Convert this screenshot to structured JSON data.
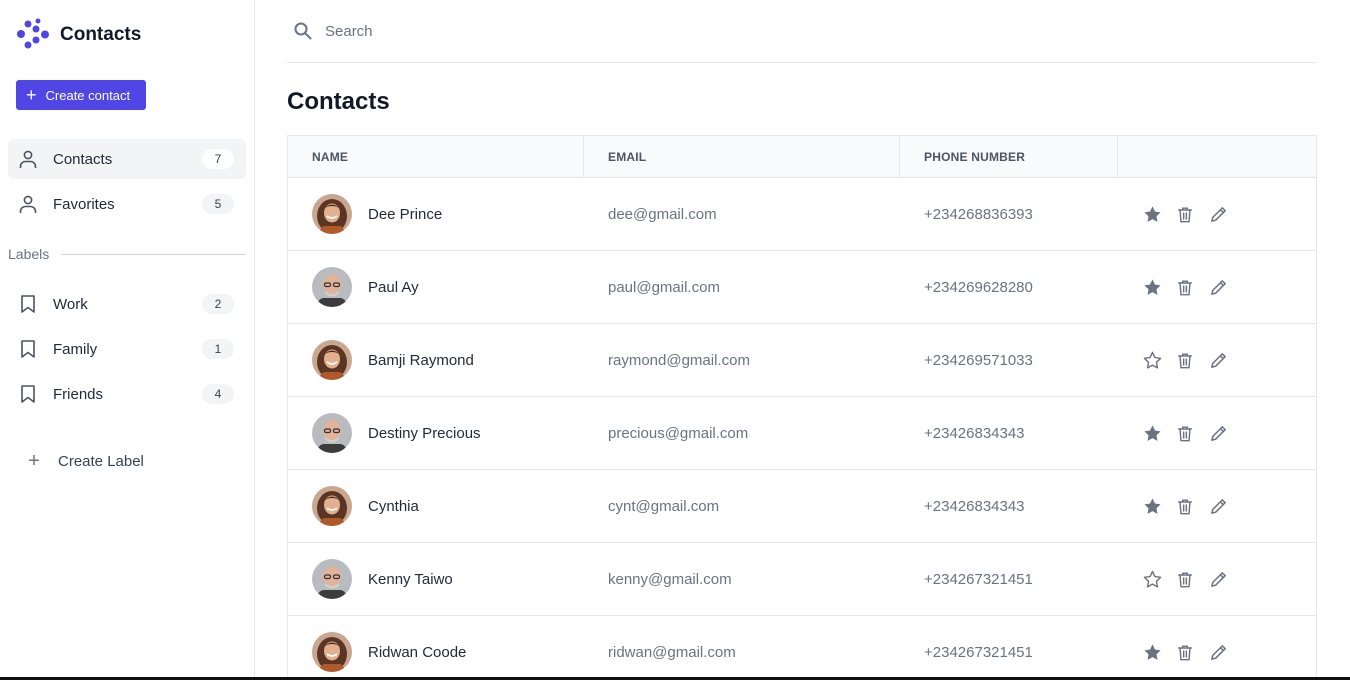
{
  "brand": {
    "name": "Contacts",
    "accent": "#4f46e5"
  },
  "sidebar": {
    "create_label": "Create contact",
    "nav": [
      {
        "label": "Contacts",
        "count": "7",
        "icon": "user-icon",
        "active": true
      },
      {
        "label": "Favorites",
        "count": "5",
        "icon": "user-icon",
        "active": false
      }
    ],
    "labels_heading": "Labels",
    "labels": [
      {
        "label": "Work",
        "count": "2",
        "icon": "bookmark-icon"
      },
      {
        "label": "Family",
        "count": "1",
        "icon": "bookmark-icon"
      },
      {
        "label": "Friends",
        "count": "4",
        "icon": "bookmark-icon"
      }
    ],
    "create_label_text": "Create Label"
  },
  "search": {
    "placeholder": "Search"
  },
  "main": {
    "title": "Contacts"
  },
  "table": {
    "columns": [
      "NAME",
      "EMAIL",
      "PHONE NUMBER",
      ""
    ],
    "rows": [
      {
        "name": "Dee Prince",
        "email": "dee@gmail.com",
        "phone": "+234268836393",
        "favorite": true,
        "avatar": "female"
      },
      {
        "name": "Paul Ay",
        "email": "paul@gmail.com",
        "phone": "+234269628280",
        "favorite": true,
        "avatar": "male"
      },
      {
        "name": "Bamji Raymond",
        "email": "raymond@gmail.com",
        "phone": "+234269571033",
        "favorite": false,
        "avatar": "female"
      },
      {
        "name": "Destiny Precious",
        "email": "precious@gmail.com",
        "phone": "+23426834343",
        "favorite": true,
        "avatar": "male"
      },
      {
        "name": "Cynthia",
        "email": "cynt@gmail.com",
        "phone": "+23426834343",
        "favorite": true,
        "avatar": "female"
      },
      {
        "name": "Kenny Taiwo",
        "email": "kenny@gmail.com",
        "phone": "+234267321451",
        "favorite": false,
        "avatar": "male"
      },
      {
        "name": "Ridwan Coode",
        "email": "ridwan@gmail.com",
        "phone": "+234267321451",
        "favorite": true,
        "avatar": "female"
      }
    ]
  }
}
